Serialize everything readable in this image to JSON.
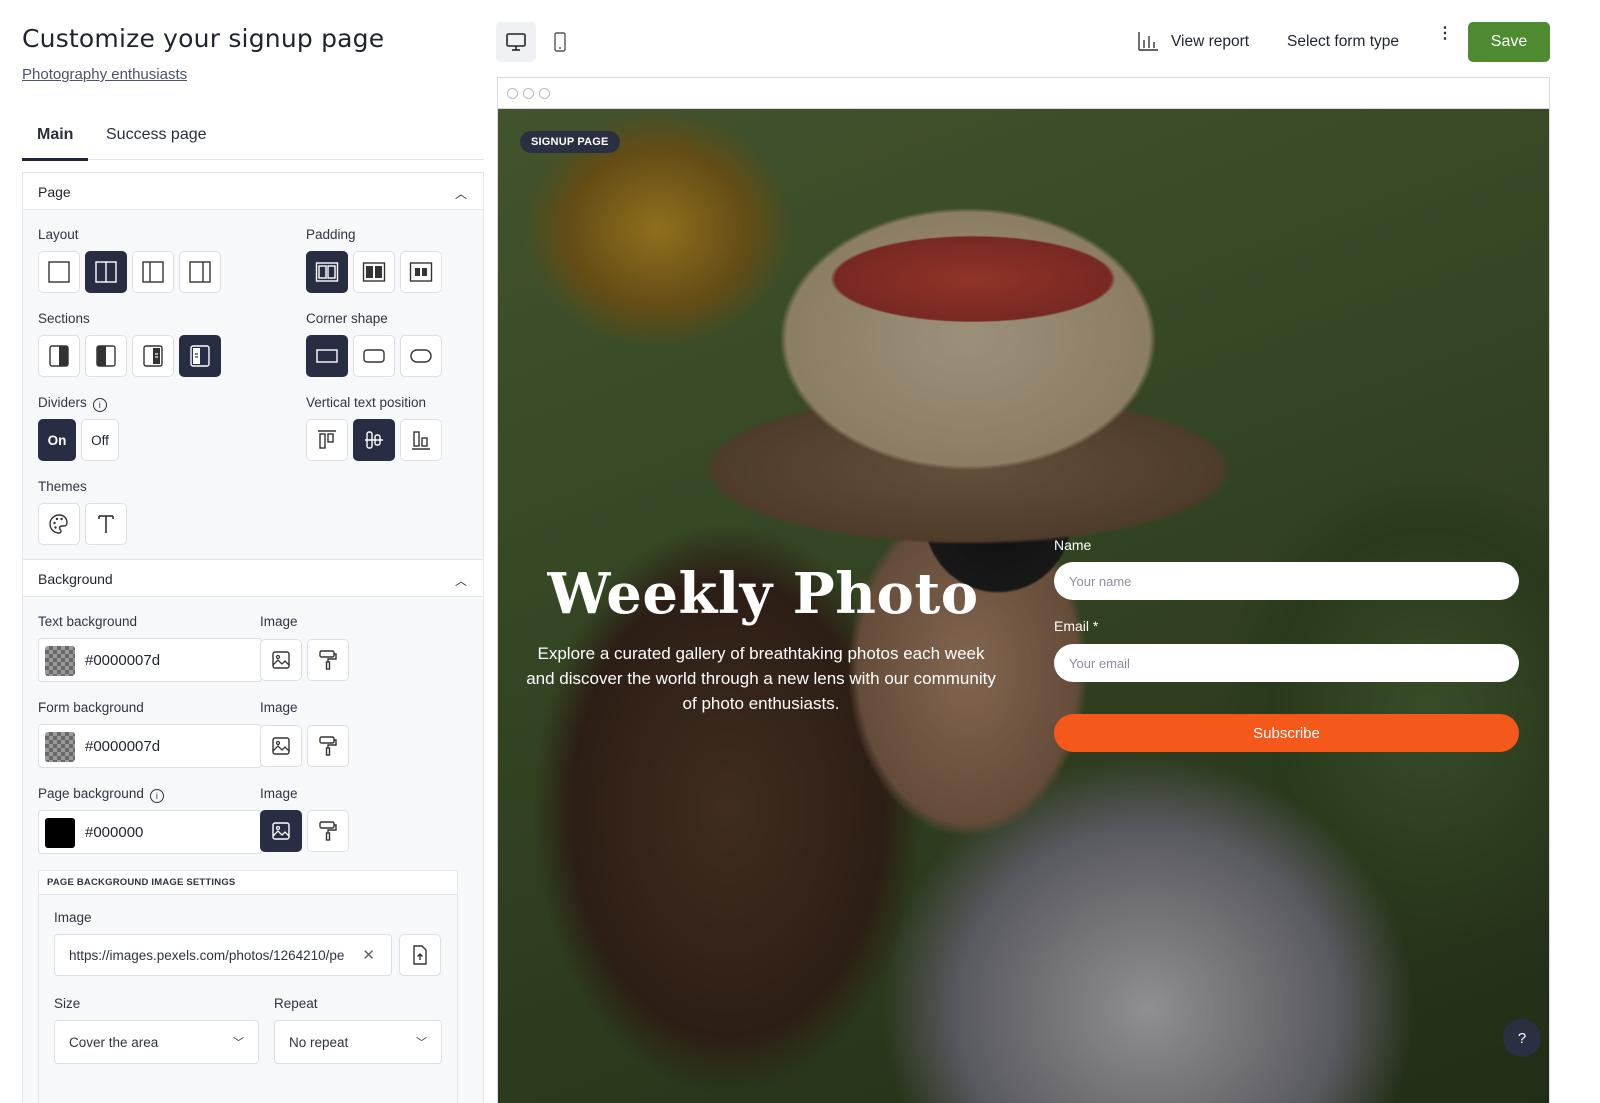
{
  "header": {
    "title": "Customize your signup page",
    "subtitle_link": "Photography enthusiasts"
  },
  "tabs": [
    {
      "label": "Main",
      "active": true
    },
    {
      "label": "Success page",
      "active": false
    }
  ],
  "page_section": {
    "title": "Page",
    "layout_label": "Layout",
    "padding_label": "Padding",
    "sections_label": "Sections",
    "corner_shape_label": "Corner shape",
    "dividers_label": "Dividers",
    "dividers_on": "On",
    "dividers_off": "Off",
    "vertical_text_position_label": "Vertical text position",
    "themes_label": "Themes"
  },
  "background_section": {
    "title": "Background",
    "text_background_label": "Text background",
    "text_background_value": "#0000007d",
    "form_background_label": "Form background",
    "form_background_value": "#0000007d",
    "page_background_label": "Page background",
    "page_background_value": "#000000",
    "image_label": "Image",
    "image_settings": {
      "title": "PAGE BACKGROUND IMAGE SETTINGS",
      "image_label": "Image",
      "image_url": "https://images.pexels.com/photos/1264210/pe",
      "size_label": "Size",
      "size_value": "Cover the area",
      "repeat_label": "Repeat",
      "repeat_value": "No repeat"
    }
  },
  "toolbar": {
    "view_report": "View report",
    "select_form_type": "Select form type",
    "more": "⋮",
    "save": "Save"
  },
  "preview": {
    "badge": "SIGNUP PAGE",
    "hero_title": "Weekly Photo",
    "hero_subtitle": "Explore a curated gallery of breathtaking photos each week and discover the world through a new lens with our community of photo enthusiasts.",
    "name_label": "Name",
    "name_placeholder": "Your name",
    "email_label": "Email *",
    "email_placeholder": "Your email",
    "subscribe": "Subscribe",
    "help": "?"
  },
  "colors": {
    "accent_dark": "#282d44",
    "save_green": "#4d8a30",
    "subscribe_orange": "#f4581b"
  }
}
